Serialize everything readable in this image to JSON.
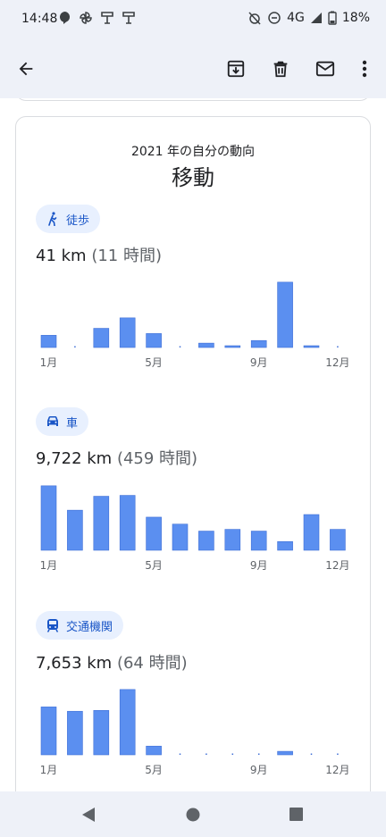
{
  "status": {
    "time": "14:48",
    "network": "4G",
    "battery": "18%"
  },
  "card": {
    "subtitle": "2021 年の自分の動向",
    "title": "移動"
  },
  "sections": [
    {
      "chip_label": "徒歩",
      "icon": "walk-icon",
      "distance": "41 km",
      "hours": "(11 時間)"
    },
    {
      "chip_label": "車",
      "icon": "car-icon",
      "distance": "9,722 km",
      "hours": "(459 時間)"
    },
    {
      "chip_label": "交通機関",
      "icon": "transit-icon",
      "distance": "7,653 km",
      "hours": "(64 時間)"
    }
  ],
  "chart_data": [
    {
      "type": "bar",
      "categories": [
        "1月",
        "2月",
        "3月",
        "4月",
        "5月",
        "6月",
        "7月",
        "8月",
        "9月",
        "10月",
        "11月",
        "12月"
      ],
      "tick_labels": [
        "1月",
        "5月",
        "9月",
        "12月"
      ],
      "values": [
        14,
        0,
        22,
        34,
        16,
        0,
        5,
        2,
        8,
        75,
        2,
        0
      ],
      "ylim": [
        0,
        80
      ],
      "color": "#5b8ff0"
    },
    {
      "type": "bar",
      "categories": [
        "1月",
        "2月",
        "3月",
        "4月",
        "5月",
        "6月",
        "7月",
        "8月",
        "9月",
        "10月",
        "11月",
        "12月"
      ],
      "tick_labels": [
        "1月",
        "5月",
        "9月",
        "12月"
      ],
      "values": [
        74,
        46,
        62,
        63,
        38,
        30,
        22,
        24,
        22,
        10,
        41,
        24
      ],
      "ylim": [
        0,
        80
      ],
      "color": "#5b8ff0"
    },
    {
      "type": "bar",
      "categories": [
        "1月",
        "2月",
        "3月",
        "4月",
        "5月",
        "6月",
        "7月",
        "8月",
        "9月",
        "10月",
        "11月",
        "12月"
      ],
      "tick_labels": [
        "1月",
        "5月",
        "9月",
        "12月"
      ],
      "values": [
        55,
        50,
        51,
        75,
        10,
        0,
        0,
        0,
        0,
        4,
        0,
        0
      ],
      "ylim": [
        0,
        80
      ],
      "color": "#5b8ff0"
    }
  ]
}
